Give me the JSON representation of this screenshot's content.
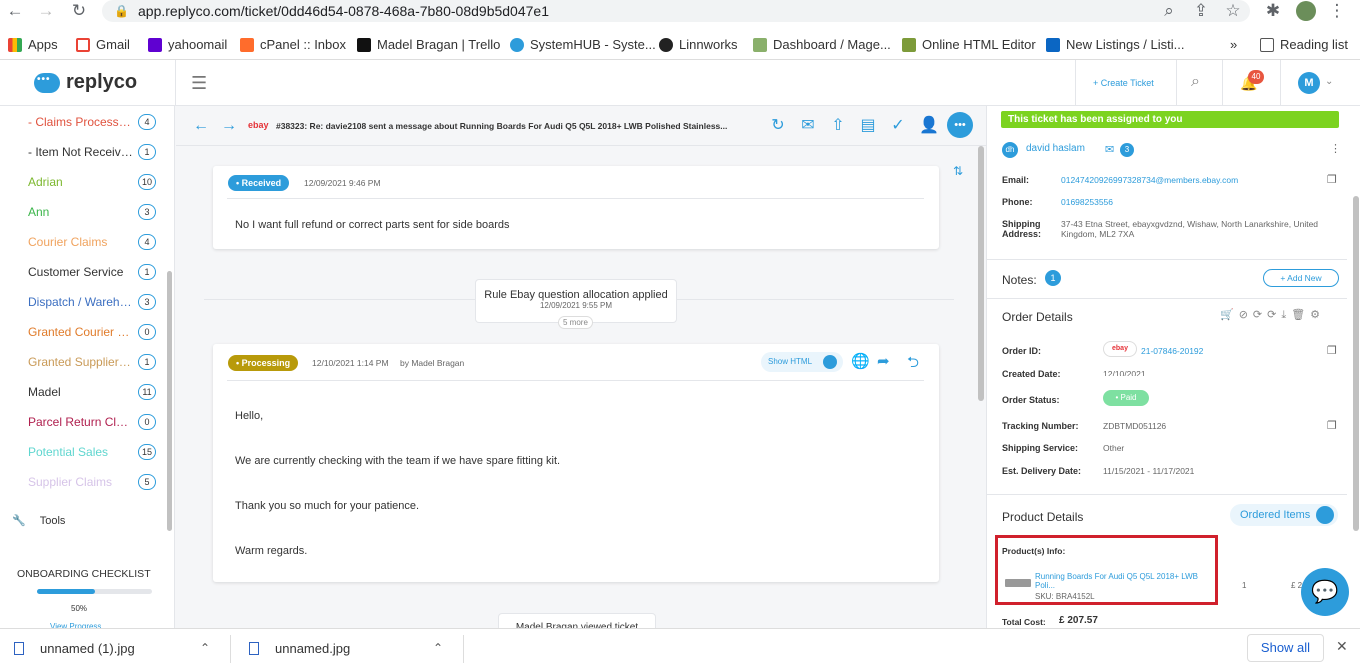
{
  "browser": {
    "url": "app.replyco.com/ticket/0dd46d54-0878-468a-7b80-08d9b5d047e1"
  },
  "bookmarks": [
    "Apps",
    "Gmail",
    "yahoomail",
    "cPanel :: Inbox",
    "Madel Bragan | Trello",
    "SystemHUB - Syste...",
    "Linnworks",
    "Dashboard / Mage...",
    "Online HTML Editor",
    "New Listings / Listi...",
    "Reading list"
  ],
  "header": {
    "logo": "replyco",
    "create_ticket": "+ Create Ticket",
    "notif_count": "40",
    "avatar": "M"
  },
  "sidebar": {
    "items": [
      {
        "label": "- Claims Processing",
        "count": "4",
        "color": "#e0533f"
      },
      {
        "label": "- Item Not Received",
        "count": "1",
        "color": "#333333"
      },
      {
        "label": "Adrian",
        "count": "10",
        "color": "#7cb82f"
      },
      {
        "label": "Ann",
        "count": "3",
        "color": "#3bb54a"
      },
      {
        "label": "Courier Claims",
        "count": "4",
        "color": "#f0a35e"
      },
      {
        "label": "Customer Service",
        "count": "1",
        "color": "#333333"
      },
      {
        "label": "Dispatch / Warehous...",
        "count": "3",
        "color": "#3c6fc1"
      },
      {
        "label": "Granted Courier Clai...",
        "count": "0",
        "color": "#e07b2a"
      },
      {
        "label": "Granted Supplier Cla...",
        "count": "1",
        "color": "#c99a57"
      },
      {
        "label": "Madel",
        "count": "11",
        "color": "#333333"
      },
      {
        "label": "Parcel Return Claims",
        "count": "0",
        "color": "#b0204f"
      },
      {
        "label": "Potential Sales",
        "count": "15",
        "color": "#5fd6cf"
      },
      {
        "label": "Supplier Claims",
        "count": "5",
        "color": "#d6c4e8"
      }
    ],
    "tools": "Tools",
    "checklist": "ONBOARDING CHECKLIST",
    "progress": "50%",
    "progress_value": 0.5,
    "view_progress": "View Progress"
  },
  "ticket": {
    "title": "#38323: Re: davie2108 sent a message about Running Boards For Audi Q5 Q5L 2018+ LWB Polished Stainless...",
    "source": "ebay"
  },
  "messages": {
    "m1": {
      "status": "• Received",
      "date": "12/09/2021 9:46 PM",
      "text": "No I want full refund or correct parts sent for side boards"
    },
    "rule": {
      "text": "Rule Ebay question allocation applied",
      "date": "12/09/2021 9:55 PM",
      "more": "5 more"
    },
    "m2": {
      "status": "• Processing",
      "date": "12/10/2021 1:14 PM",
      "by": "by Madel Bragan",
      "show_html": "Show HTML",
      "lines": [
        "Hello,",
        "We are currently checking with the team if we have spare fitting kit.",
        "Thank you so much for your patience.",
        "Warm regards."
      ]
    },
    "viewed": "Madel Bragan viewed ticket"
  },
  "customer": {
    "assigned": "This ticket has been assigned to you",
    "initials": "dh",
    "name": "david haslam",
    "msg_count": "3",
    "email_label": "Email:",
    "email": "01247420926997328734@members.ebay.com",
    "phone_label": "Phone:",
    "phone": "01698253556",
    "ship_label": "Shipping Address:",
    "ship": "37-43 Etna Street, ebayxgvdznd, Wishaw, North Lanarkshire, United Kingdom, ML2 7XA"
  },
  "notes": {
    "label": "Notes:",
    "count": "1",
    "add": "+ Add New"
  },
  "order": {
    "title": "Order Details",
    "id_label": "Order ID:",
    "id_source": "ebay",
    "id": "21-07846-20192",
    "created_label": "Created Date:",
    "created": "12/10/2021",
    "status_label": "Order Status:",
    "status": "• Paid",
    "tracking_label": "Tracking Number:",
    "tracking": "ZDBTMD051126",
    "service_label": "Shipping Service:",
    "service": "Other",
    "delivery_label": "Est. Delivery Date:",
    "delivery": "11/15/2021 - 11/17/2021"
  },
  "product": {
    "title": "Product Details",
    "ordered": "Ordered Items",
    "info_label": "Product(s) Info:",
    "name": "Running Boards For Audi Q5 Q5L 2018+ LWB Poli...",
    "sku": "SKU: BRA4152L",
    "qty": "1",
    "price": "£ 20",
    "total_label": "Total Cost:",
    "total": "£ 207.57"
  },
  "downloads": {
    "files": [
      "unnamed (1).jpg",
      "unnamed.jpg"
    ],
    "show_all": "Show all"
  }
}
